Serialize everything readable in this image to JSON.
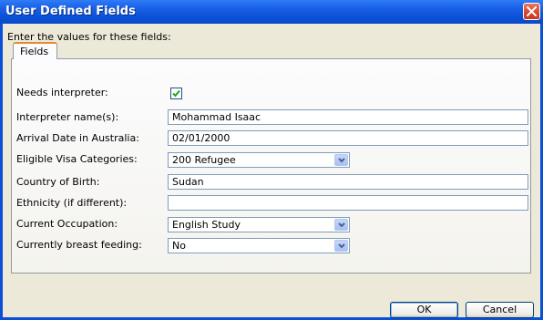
{
  "window": {
    "title": "User Defined Fields",
    "prompt": "Enter the values for these fields:"
  },
  "tabs": [
    {
      "label": "Fields",
      "selected": true
    }
  ],
  "fields": {
    "needs_interpreter": {
      "label": "Needs interpreter:",
      "checked": true
    },
    "interpreter_names": {
      "label": "Interpreter name(s):",
      "value": "Mohammad Isaac"
    },
    "arrival_date": {
      "label": "Arrival Date in Australia:",
      "value": "02/01/2000"
    },
    "visa_categories": {
      "label": "Eligible Visa Categories:",
      "value": "200  Refugee"
    },
    "country_of_birth": {
      "label": "Country of Birth:",
      "value": "Sudan"
    },
    "ethnicity": {
      "label": "Ethnicity (if different):",
      "value": ""
    },
    "current_occupation": {
      "label": "Current Occupation:",
      "value": "English Study"
    },
    "breast_feeding": {
      "label": "Currently breast feeding:",
      "value": "No"
    }
  },
  "buttons": {
    "ok": "OK",
    "cancel": "Cancel"
  },
  "colors": {
    "title_bar": "#0a52d8",
    "dialog_face": "#ece9d8",
    "tab_accent": "#e68b2c",
    "close_button": "#d8482c"
  },
  "icons": {
    "close": "close-icon",
    "dropdown": "chevron-down-icon",
    "check": "checkmark-icon"
  }
}
